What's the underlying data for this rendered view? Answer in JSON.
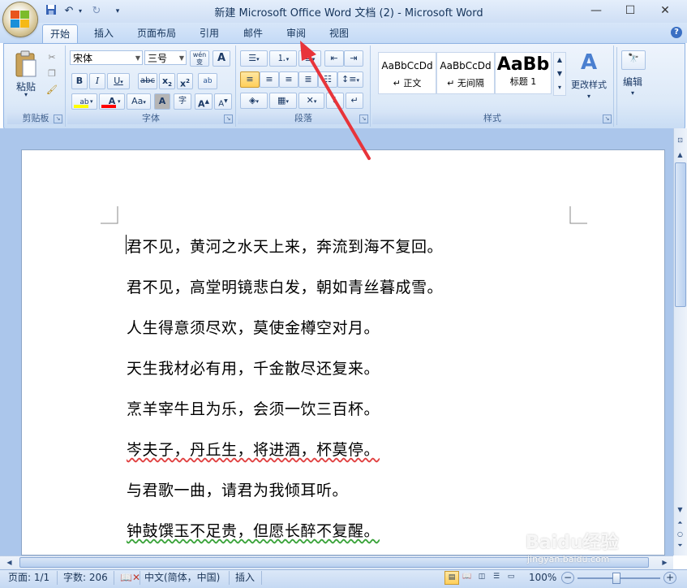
{
  "window": {
    "title": "新建 Microsoft Office Word 文档 (2) - Microsoft Word"
  },
  "quick_access": {
    "icons": [
      "save-icon",
      "undo-icon",
      "redo-icon",
      "customize-icon"
    ]
  },
  "tabs": [
    {
      "label": "开始",
      "active": true
    },
    {
      "label": "插入"
    },
    {
      "label": "页面布局"
    },
    {
      "label": "引用"
    },
    {
      "label": "邮件"
    },
    {
      "label": "审阅"
    },
    {
      "label": "视图"
    }
  ],
  "clipboard": {
    "paste_label": "粘贴",
    "group_label": "剪贴板"
  },
  "font": {
    "family": "宋体",
    "size": "三号",
    "group_label": "字体",
    "wen_label": "wén",
    "A_label": "A",
    "bold": "B",
    "italic": "I",
    "underline": "U",
    "strike": "abc",
    "sub": "x",
    "sup": "x",
    "font_color_letter": "A",
    "aa_label": "Aa",
    "grow_label": "A",
    "shrink_label": "A",
    "char_shade_label": "A",
    "enclose_label": "字",
    "pinyin_label": "ab"
  },
  "paragraph": {
    "group_label": "段落"
  },
  "styles": {
    "group_label": "样式",
    "items": [
      {
        "sample": "AaBbCcDd",
        "name": "↵ 正文"
      },
      {
        "sample": "AaBbCcDd",
        "name": "↵ 无间隔"
      },
      {
        "sample": "AaBb",
        "name": "标题 1"
      }
    ],
    "change_styles_label": "更改样式"
  },
  "editing": {
    "label": "编辑"
  },
  "document": {
    "lines": [
      "君不见，黄河之水天上来，奔流到海不复回。",
      "君不见，高堂明镜悲白发，朝如青丝暮成雪。",
      "人生得意须尽欢，莫使金樽空对月。",
      "天生我材必有用，千金散尽还复来。",
      "烹羊宰牛且为乐，会须一饮三百杯。",
      "岑夫子，丹丘生，将进酒，杯莫停。",
      "与君歌一曲，请君为我倾耳听。",
      "钟鼓馔玉不足贵，但愿长醉不复醒。"
    ]
  },
  "statusbar": {
    "page": "页面: 1/1",
    "words": "字数: 206",
    "language": "中文(简体，中国)",
    "mode": "插入",
    "zoom": "100%"
  },
  "watermark": {
    "text": "Baidu经验",
    "sub": "jingyan.baidu.com"
  },
  "colors": {
    "accent": "#1e5aa8",
    "highlight": "#ffff00",
    "font_color": "#ff0000",
    "arrow": "#e8343a"
  }
}
